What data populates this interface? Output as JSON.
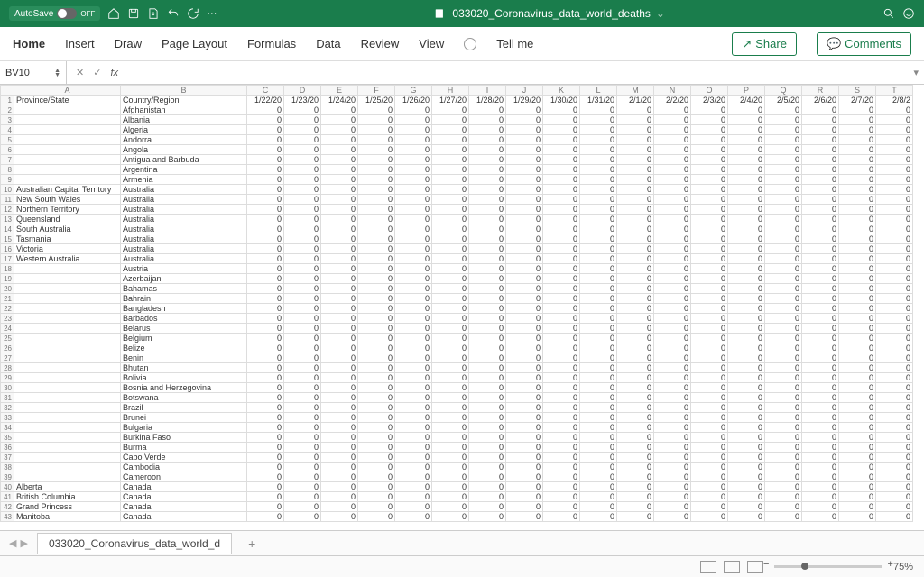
{
  "titlebar": {
    "autosave_label": "AutoSave",
    "autosave_state": "OFF",
    "doc_title": "033020_Coronavirus_data_world_deaths"
  },
  "ribbon": {
    "tabs": [
      "Home",
      "Insert",
      "Draw",
      "Page Layout",
      "Formulas",
      "Data",
      "Review",
      "View",
      "Tell me"
    ],
    "share_label": "Share",
    "comments_label": "Comments"
  },
  "formula_bar": {
    "name_box": "BV10",
    "fx_label": "fx"
  },
  "sheet": {
    "col_letters": [
      "A",
      "B",
      "C",
      "D",
      "E",
      "F",
      "G",
      "H",
      "I",
      "J",
      "K",
      "L",
      "M",
      "N",
      "O",
      "P",
      "Q",
      "R",
      "S",
      "T"
    ],
    "header_row": [
      "Province/State",
      "Country/Region",
      "1/22/20",
      "1/23/20",
      "1/24/20",
      "1/25/20",
      "1/26/20",
      "1/27/20",
      "1/28/20",
      "1/29/20",
      "1/30/20",
      "1/31/20",
      "2/1/20",
      "2/2/20",
      "2/3/20",
      "2/4/20",
      "2/5/20",
      "2/6/20",
      "2/7/20",
      "2/8/2"
    ],
    "rows": [
      [
        "",
        "Afghanistan"
      ],
      [
        "",
        "Albania"
      ],
      [
        "",
        "Algeria"
      ],
      [
        "",
        "Andorra"
      ],
      [
        "",
        "Angola"
      ],
      [
        "",
        "Antigua and Barbuda"
      ],
      [
        "",
        "Argentina"
      ],
      [
        "",
        "Armenia"
      ],
      [
        "Australian Capital Territory",
        "Australia"
      ],
      [
        "New South Wales",
        "Australia"
      ],
      [
        "Northern Territory",
        "Australia"
      ],
      [
        "Queensland",
        "Australia"
      ],
      [
        "South Australia",
        "Australia"
      ],
      [
        "Tasmania",
        "Australia"
      ],
      [
        "Victoria",
        "Australia"
      ],
      [
        "Western Australia",
        "Australia"
      ],
      [
        "",
        "Austria"
      ],
      [
        "",
        "Azerbaijan"
      ],
      [
        "",
        "Bahamas"
      ],
      [
        "",
        "Bahrain"
      ],
      [
        "",
        "Bangladesh"
      ],
      [
        "",
        "Barbados"
      ],
      [
        "",
        "Belarus"
      ],
      [
        "",
        "Belgium"
      ],
      [
        "",
        "Belize"
      ],
      [
        "",
        "Benin"
      ],
      [
        "",
        "Bhutan"
      ],
      [
        "",
        "Bolivia"
      ],
      [
        "",
        "Bosnia and Herzegovina"
      ],
      [
        "",
        "Botswana"
      ],
      [
        "",
        "Brazil"
      ],
      [
        "",
        "Brunei"
      ],
      [
        "",
        "Bulgaria"
      ],
      [
        "",
        "Burkina Faso"
      ],
      [
        "",
        "Burma"
      ],
      [
        "",
        "Cabo Verde"
      ],
      [
        "",
        "Cambodia"
      ],
      [
        "",
        "Cameroon"
      ],
      [
        "Alberta",
        "Canada"
      ],
      [
        "British Columbia",
        "Canada"
      ],
      [
        "Grand Princess",
        "Canada"
      ],
      [
        "Manitoba",
        "Canada"
      ]
    ],
    "zero": "0"
  },
  "tabs": {
    "sheet_name": "033020_Coronavirus_data_world_d",
    "add": "+"
  },
  "status": {
    "zoom": "75%"
  }
}
